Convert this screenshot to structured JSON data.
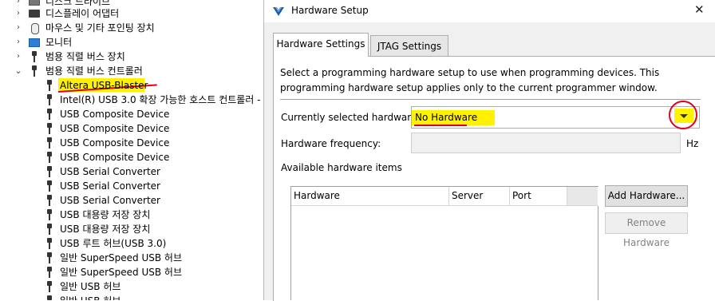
{
  "tree": {
    "items": [
      {
        "label": "디스크 드라이브",
        "icon": "disk-drive-icon",
        "expanded": false
      },
      {
        "label": "디스플레이 어댑터",
        "icon": "display-adapter-icon",
        "expanded": false
      },
      {
        "label": "마우스 및 기타 포인팅 장치",
        "icon": "mouse-icon",
        "expanded": false
      },
      {
        "label": "모니터",
        "icon": "monitor-icon",
        "expanded": false
      },
      {
        "label": "범용 직렬 버스 장치",
        "icon": "usb-icon",
        "expanded": false
      },
      {
        "label": "범용 직렬 버스 컨트롤러",
        "icon": "usb-icon",
        "expanded": true
      }
    ],
    "children": [
      "Altera USB-Blaster",
      "Intel(R) USB 3.0 확장 가능한 호스트 컨트롤러 -",
      "USB Composite Device",
      "USB Composite Device",
      "USB Composite Device",
      "USB Composite Device",
      "USB Serial Converter",
      "USB Serial Converter",
      "USB Serial Converter",
      "USB 대용량 저장 장치",
      "USB 대용량 저장 장치",
      "USB 루트 허브(USB 3.0)",
      "일반 SuperSpeed USB 허브",
      "일반 SuperSpeed USB 허브",
      "일반 USB 허브",
      "일반 USB 허브"
    ]
  },
  "dialog": {
    "title": "Hardware Setup",
    "close_icon": "close-icon",
    "tabs": [
      {
        "label": "Hardware Settings",
        "active": true
      },
      {
        "label": "JTAG Settings",
        "active": false
      }
    ],
    "description": "Select a programming hardware setup to use when programming devices. This programming hardware setup applies only to the current programmer window.",
    "current_hardware_label": "Currently selected hardware:",
    "current_hardware_value": "No Hardware",
    "frequency_label": "Hardware frequency:",
    "frequency_value": "",
    "frequency_unit": "Hz",
    "available_label": "Available hardware items",
    "table": {
      "columns": [
        "Hardware",
        "Server",
        "Port"
      ],
      "rows": []
    },
    "add_button": "Add Hardware...",
    "remove_button": "Remove Hardware"
  },
  "annotations": {
    "highlight_color": "#fff200",
    "mark_color": "#e0001b"
  }
}
